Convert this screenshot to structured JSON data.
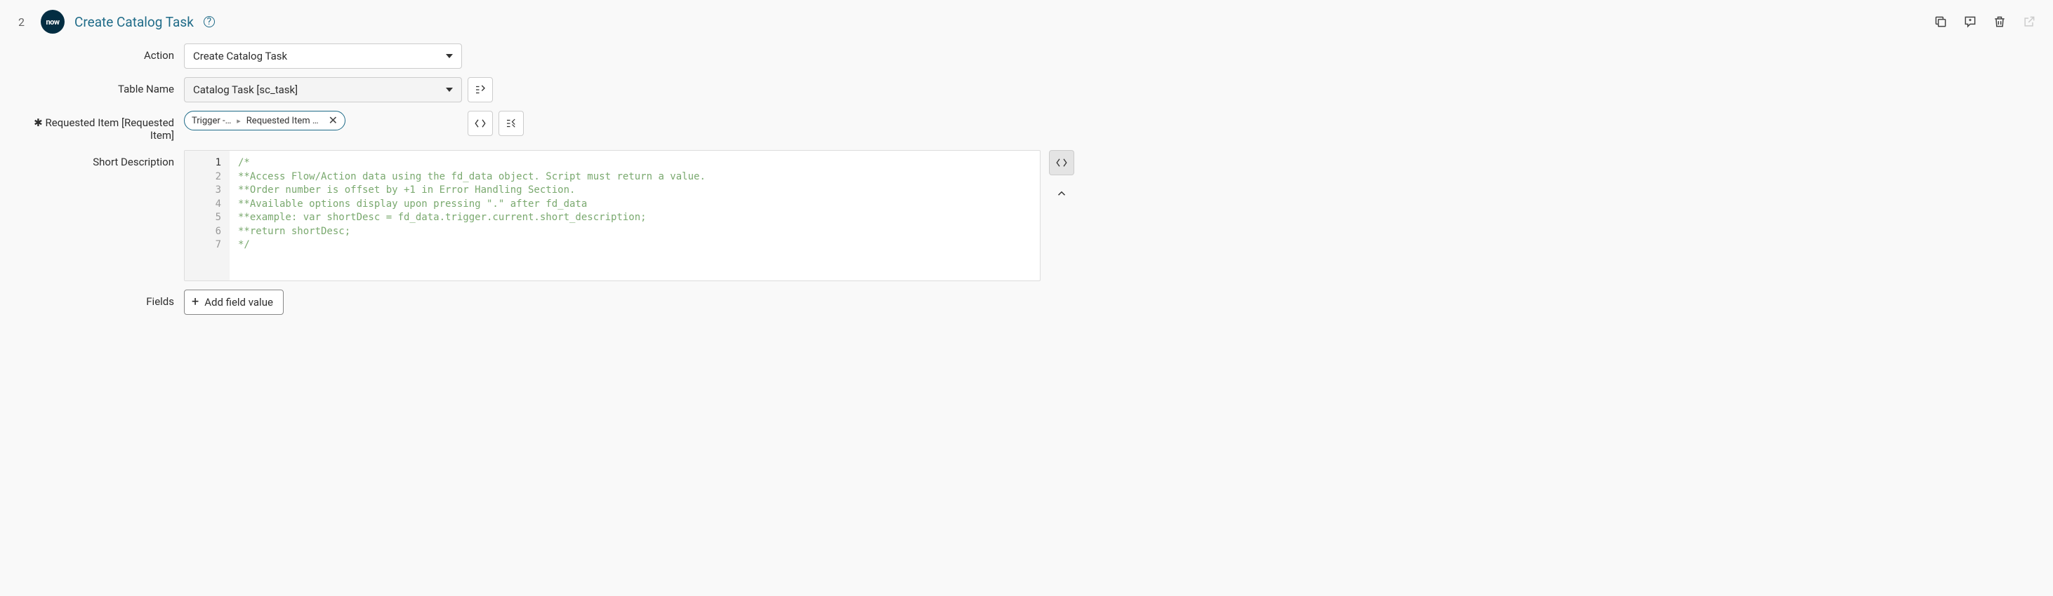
{
  "header": {
    "step_number": "2",
    "logo_text": "now",
    "title": "Create Catalog Task"
  },
  "form": {
    "action": {
      "label": "Action",
      "value": "Create Catalog Task"
    },
    "table_name": {
      "label": "Table Name",
      "value": "Catalog Task [sc_task]"
    },
    "requested_item": {
      "label": "✱ Requested Item [Requested Item]",
      "pill_part1": "Trigger -…",
      "pill_part2": "Requested Item …"
    },
    "short_description": {
      "label": "Short Description",
      "lines": [
        "/*",
        "**Access Flow/Action data using the fd_data object. Script must return a value.",
        "**Order number is offset by +1 in Error Handling Section.",
        "**Available options display upon pressing \".\" after fd_data",
        "**example: var shortDesc = fd_data.trigger.current.short_description;",
        "**return shortDesc;",
        "*/"
      ]
    },
    "fields": {
      "label": "Fields",
      "button": "Add field value"
    }
  }
}
